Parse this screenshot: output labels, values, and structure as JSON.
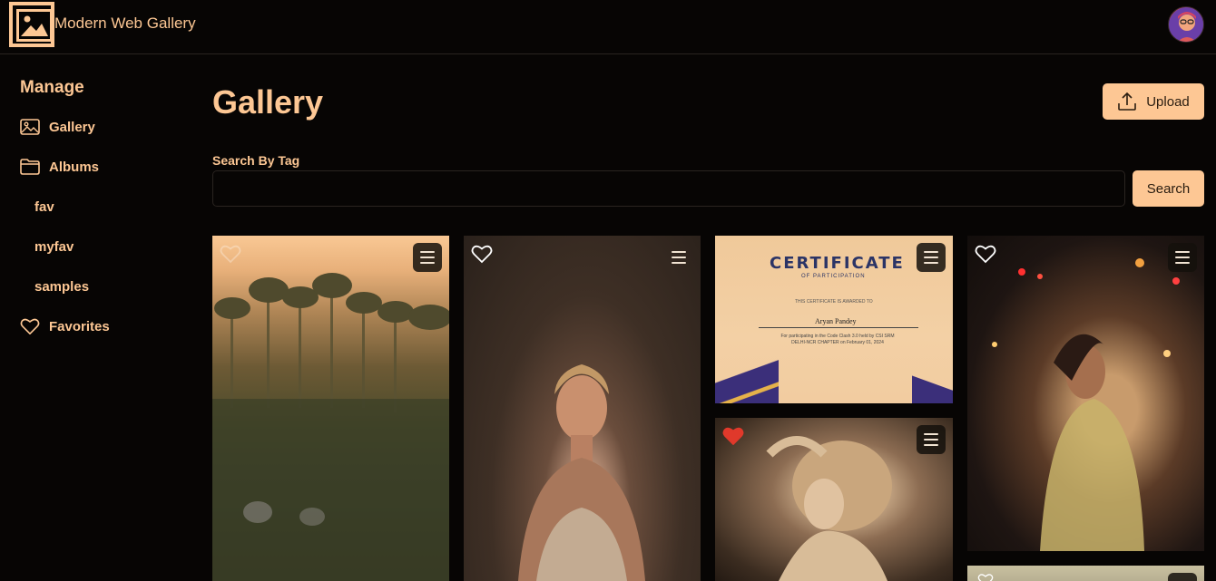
{
  "header": {
    "app_title": "Modern Web Gallery",
    "logo_icon": "gallery-logo-icon",
    "avatar_icon": "user-avatar"
  },
  "sidebar": {
    "section_title": "Manage",
    "items": [
      {
        "label": "Gallery",
        "icon": "image-icon"
      },
      {
        "label": "Albums",
        "icon": "folder-icon"
      }
    ],
    "albums": [
      "fav",
      "myfav",
      "samples"
    ],
    "favorites": {
      "label": "Favorites",
      "icon": "heart-icon"
    }
  },
  "main": {
    "page_title": "Gallery",
    "upload_label": "Upload",
    "search_label": "Search By Tag",
    "search_value": "",
    "search_button": "Search"
  },
  "photos": [
    {
      "id": "forest-fog",
      "favorite": false
    },
    {
      "id": "woman-portrait",
      "favorite": false
    },
    {
      "id": "certificate",
      "favorite": false
    },
    {
      "id": "woman-curly-hair",
      "favorite": true
    },
    {
      "id": "woman-street-night",
      "favorite": false
    },
    {
      "id": "partial-photo",
      "favorite": false
    }
  ],
  "certificate": {
    "title": "CERTIFICATE",
    "subtitle": "OF PARTICIPATION",
    "awarded_line": "THIS CERTIFICATE IS AWARDED TO",
    "name": "Aryan Pandey",
    "body": "For participating in the Code Clash 3.0 held by CSI SRM DELHI-NCR CHAPTER on February 01, 2024"
  },
  "colors": {
    "accent": "#fdc794",
    "background": "#070504",
    "favorite_red": "#e0392b"
  }
}
